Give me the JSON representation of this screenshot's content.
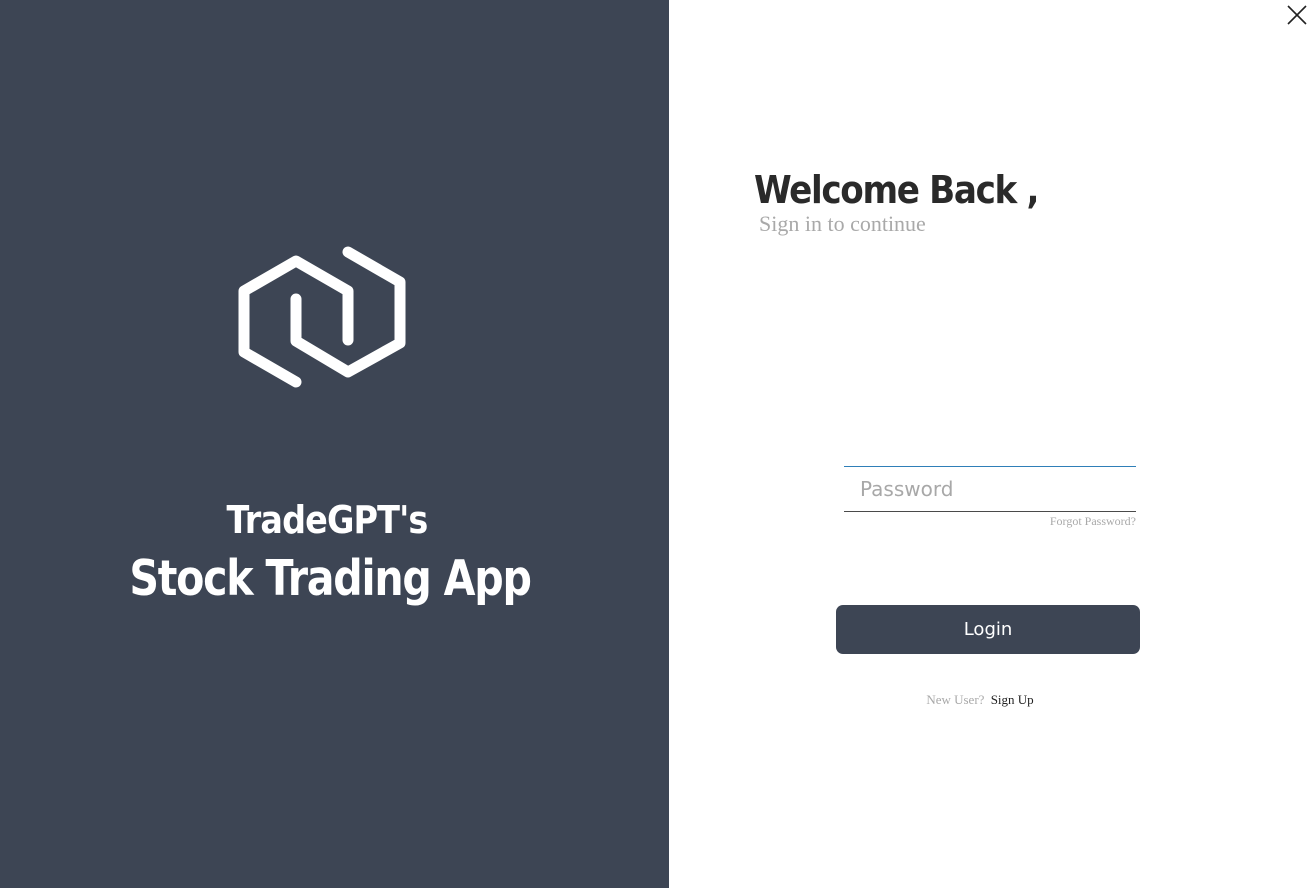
{
  "brand": {
    "line1": "TradeGPT's",
    "line2": "Stock Trading App",
    "logo_icon": "hexagon-link-logo-icon"
  },
  "window": {
    "close_icon": "close-icon"
  },
  "login": {
    "title": "Welcome Back ,",
    "subtitle": "Sign in to continue",
    "password_placeholder": "Password",
    "password_value": "",
    "forgot_password": "Forgot Password?",
    "login_label": "Login",
    "new_user_label": "New User?",
    "signup_label": "Sign Up"
  },
  "colors": {
    "panel_background": "#3d4554",
    "button_background": "#3d4554",
    "field_top_border": "#2f7fb8"
  }
}
